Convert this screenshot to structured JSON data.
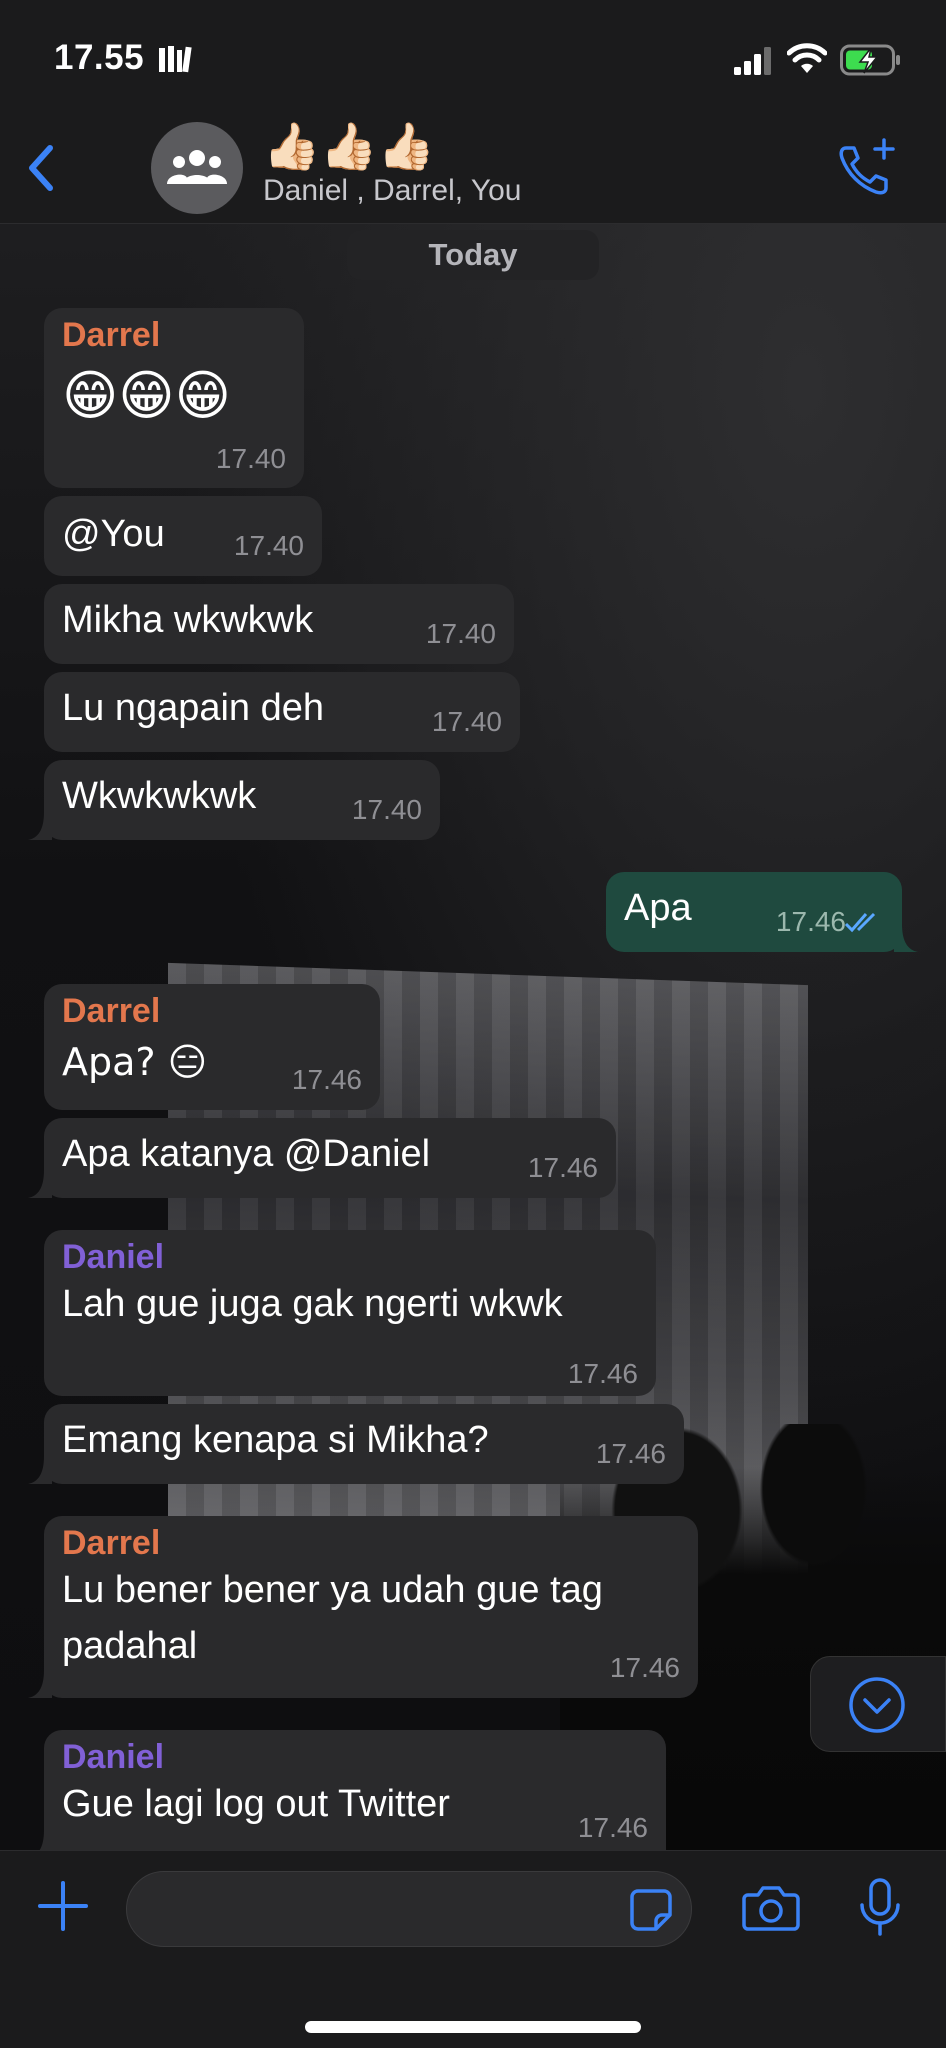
{
  "status_bar": {
    "time": "17.55"
  },
  "header": {
    "group_name": "👍🏻👍🏻👍🏻",
    "members": "Daniel , Darrel, You"
  },
  "date_separator": "Today",
  "messages": [
    {
      "sender": "Darrel",
      "text": "😁😁😁",
      "time": "17.40",
      "direction": "in"
    },
    {
      "sender": "",
      "text": "@You",
      "time": "17.40",
      "direction": "in"
    },
    {
      "sender": "",
      "text": "Mikha wkwkwk",
      "time": "17.40",
      "direction": "in"
    },
    {
      "sender": "",
      "text": "Lu ngapain deh",
      "time": "17.40",
      "direction": "in"
    },
    {
      "sender": "",
      "text": "Wkwkwkwk",
      "time": "17.40",
      "direction": "in"
    },
    {
      "sender": "",
      "text": "Apa",
      "time": "17.46",
      "direction": "out",
      "status": "read"
    },
    {
      "sender": "Darrel",
      "text": "Apa? 😑",
      "time": "17.46",
      "direction": "in"
    },
    {
      "sender": "",
      "text": "Apa katanya @Daniel",
      "time": "17.46",
      "direction": "in"
    },
    {
      "sender": "Daniel",
      "text": "Lah gue juga gak ngerti wkwk",
      "time": "17.46",
      "direction": "in"
    },
    {
      "sender": "",
      "text": "Emang kenapa si Mikha?",
      "time": "17.46",
      "direction": "in"
    },
    {
      "sender": "Darrel",
      "text": "Lu bener bener ya udah gue tag",
      "text2": "padahal",
      "time": "17.46",
      "direction": "in"
    },
    {
      "sender": "Daniel",
      "text": "Gue lagi log out Twitter",
      "time": "17.46",
      "direction": "in"
    }
  ],
  "colors": {
    "accent": "#3b82f6",
    "darrel": "#e3774d",
    "daniel": "#8160d6",
    "incoming_bubble": "#2a2a2c",
    "outgoing_bubble": "#1f4a3f"
  },
  "icons": [
    "back-chevron-icon",
    "group-icon",
    "add-call-icon",
    "plus-icon",
    "sticker-icon",
    "camera-icon",
    "mic-icon",
    "chevron-down-icon"
  ]
}
